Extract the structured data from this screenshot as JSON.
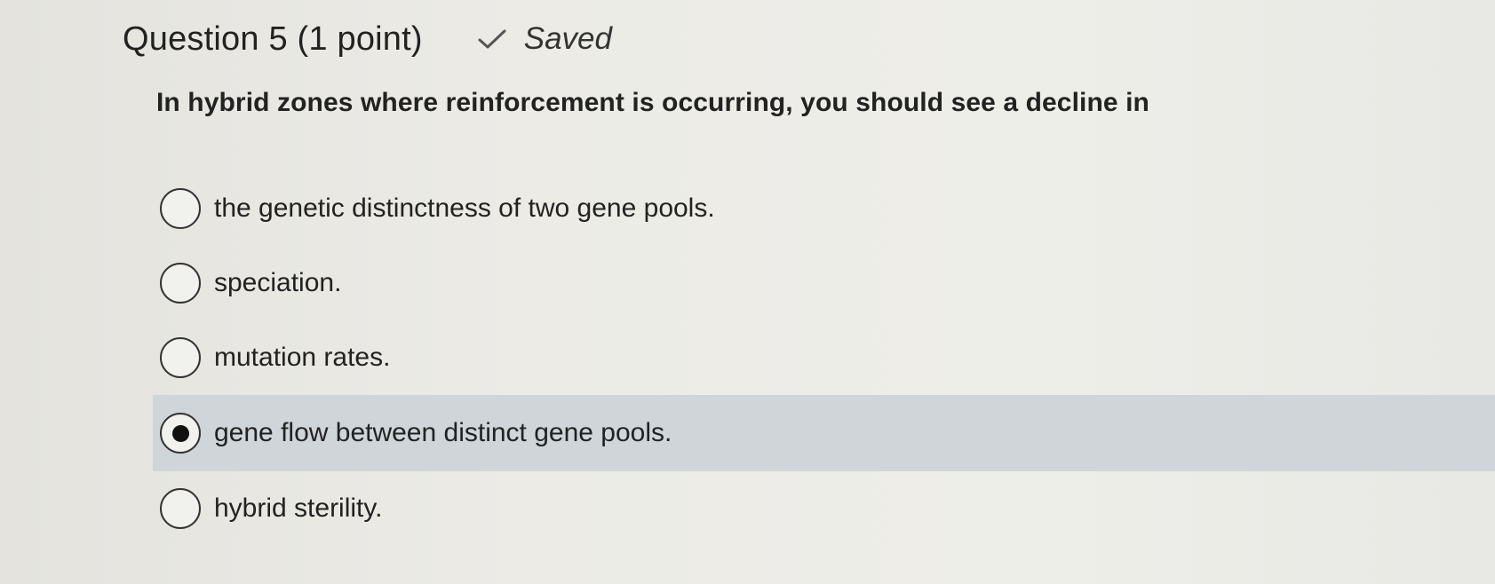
{
  "question": {
    "title": "Question 5 (1 point)",
    "status": "Saved",
    "status_icon": "check-icon",
    "prompt": "In hybrid zones where reinforcement is occurring, you should see a decline in",
    "choices": [
      {
        "label": "the genetic distinctness of two gene pools.",
        "selected": false
      },
      {
        "label": "speciation.",
        "selected": false
      },
      {
        "label": "mutation rates.",
        "selected": false
      },
      {
        "label": "gene flow between distinct gene pools.",
        "selected": true
      },
      {
        "label": "hybrid sterility.",
        "selected": false
      }
    ]
  },
  "colors": {
    "background": "#e9e8e3",
    "selected_row": "#cfd5d8",
    "text": "#222222"
  }
}
